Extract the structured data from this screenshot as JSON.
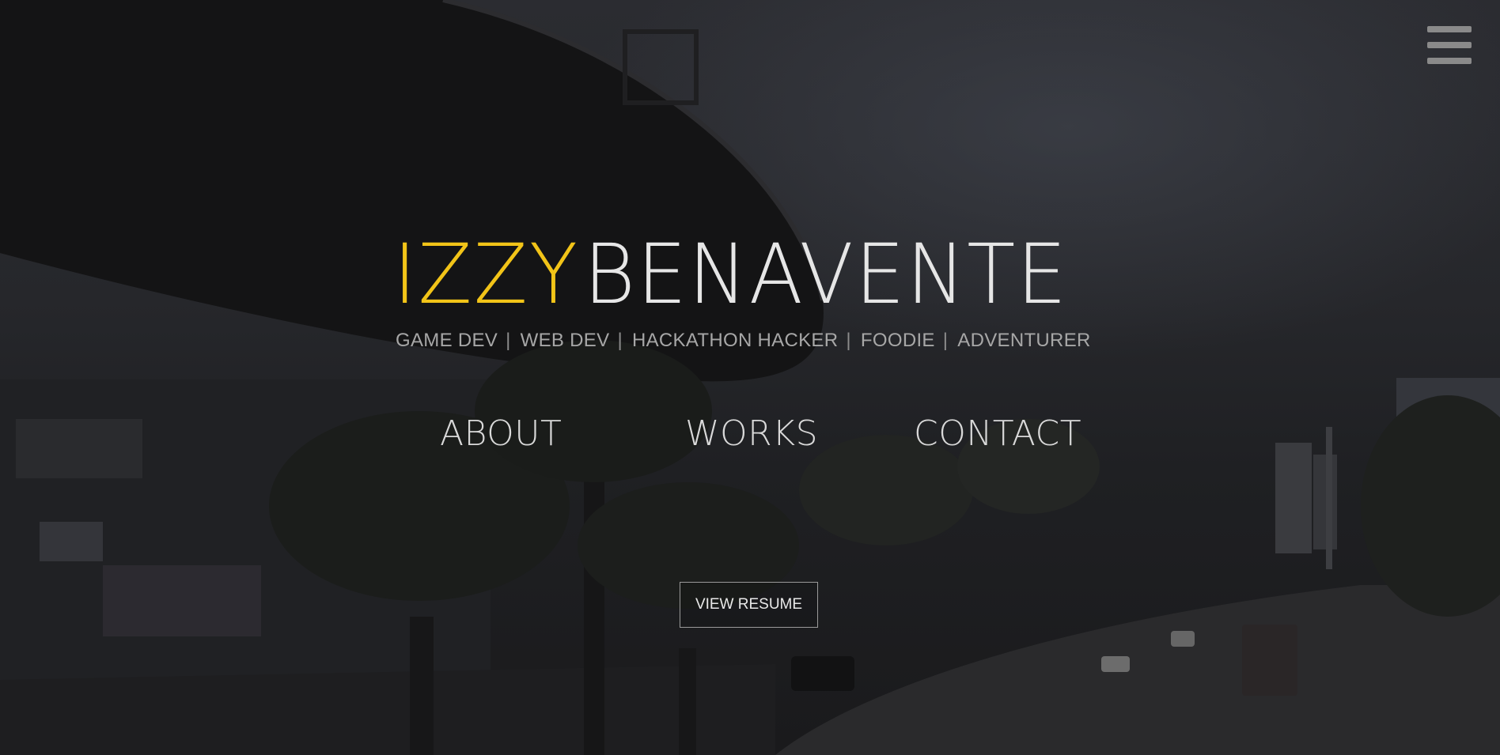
{
  "header": {
    "menu_icon": "hamburger-menu-icon"
  },
  "hero": {
    "first_name": "IZZY",
    "last_name": "BENAVENTE",
    "taglines": [
      "GAME DEV",
      "WEB DEV",
      "HACKATHON HACKER",
      "FOODIE",
      "ADVENTURER"
    ],
    "separator": "|"
  },
  "nav": {
    "about": "ABOUT",
    "works": "WORKS",
    "contact": "CONTACT"
  },
  "cta": {
    "resume_label": "VIEW RESUME"
  },
  "colors": {
    "accent": "#f2c418",
    "text_light": "#e6e6e6",
    "text_muted": "#a7a7a7"
  }
}
